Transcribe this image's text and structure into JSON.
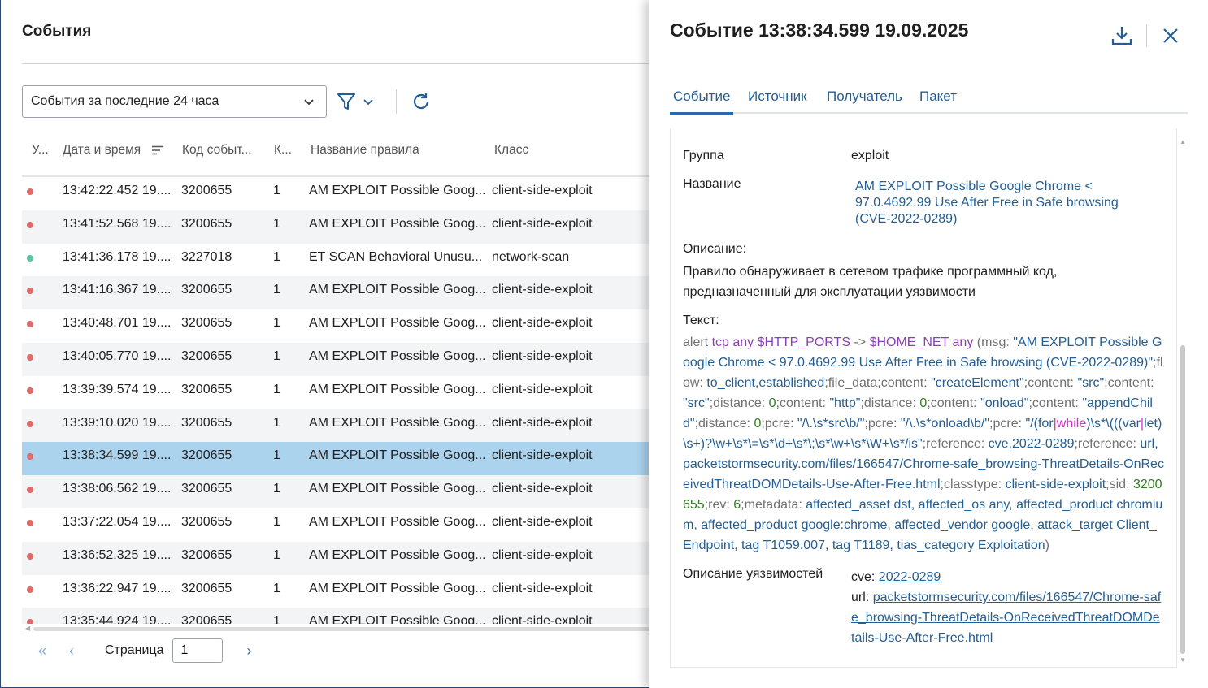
{
  "page": {
    "title": "События"
  },
  "toolbar": {
    "period": "События за последние 24 часа"
  },
  "table": {
    "headers": [
      "У...",
      "Дата и время",
      "Код событ...",
      "К...",
      "Название правила",
      "Класс"
    ],
    "rows": [
      {
        "level": "high",
        "datetime": "13:42:22.452 19....",
        "code": "3200655",
        "count": "1",
        "rule": "AM EXPLOIT Possible Goog...",
        "class": "client-side-exploit"
      },
      {
        "level": "high",
        "datetime": "13:41:52.568 19....",
        "code": "3200655",
        "count": "1",
        "rule": "AM EXPLOIT Possible Goog...",
        "class": "client-side-exploit"
      },
      {
        "level": "low",
        "datetime": "13:41:36.178 19....",
        "code": "3227018",
        "count": "1",
        "rule": "ET SCAN Behavioral Unusu...",
        "class": "network-scan"
      },
      {
        "level": "high",
        "datetime": "13:41:16.367 19....",
        "code": "3200655",
        "count": "1",
        "rule": "AM EXPLOIT Possible Goog...",
        "class": "client-side-exploit"
      },
      {
        "level": "high",
        "datetime": "13:40:48.701 19....",
        "code": "3200655",
        "count": "1",
        "rule": "AM EXPLOIT Possible Goog...",
        "class": "client-side-exploit"
      },
      {
        "level": "high",
        "datetime": "13:40:05.770 19....",
        "code": "3200655",
        "count": "1",
        "rule": "AM EXPLOIT Possible Goog...",
        "class": "client-side-exploit"
      },
      {
        "level": "high",
        "datetime": "13:39:39.574 19....",
        "code": "3200655",
        "count": "1",
        "rule": "AM EXPLOIT Possible Goog...",
        "class": "client-side-exploit"
      },
      {
        "level": "high",
        "datetime": "13:39:10.020 19....",
        "code": "3200655",
        "count": "1",
        "rule": "AM EXPLOIT Possible Goog...",
        "class": "client-side-exploit"
      },
      {
        "level": "high",
        "datetime": "13:38:34.599 19....",
        "code": "3200655",
        "count": "1",
        "rule": "AM EXPLOIT Possible Goog...",
        "class": "client-side-exploit"
      },
      {
        "level": "high",
        "datetime": "13:38:06.562 19....",
        "code": "3200655",
        "count": "1",
        "rule": "AM EXPLOIT Possible Goog...",
        "class": "client-side-exploit"
      },
      {
        "level": "high",
        "datetime": "13:37:22.054 19....",
        "code": "3200655",
        "count": "1",
        "rule": "AM EXPLOIT Possible Goog...",
        "class": "client-side-exploit"
      },
      {
        "level": "high",
        "datetime": "13:36:52.325 19....",
        "code": "3200655",
        "count": "1",
        "rule": "AM EXPLOIT Possible Goog...",
        "class": "client-side-exploit"
      },
      {
        "level": "high",
        "datetime": "13:36:22.947 19....",
        "code": "3200655",
        "count": "1",
        "rule": "AM EXPLOIT Possible Goog...",
        "class": "client-side-exploit"
      },
      {
        "level": "high",
        "datetime": "13:35:44.924 19....",
        "code": "3200655",
        "count": "1",
        "rule": "AM EXPLOIT Possible Goog...",
        "class": "client-side-exploit"
      }
    ],
    "selected_index": 8
  },
  "pager": {
    "label": "Страница",
    "page": "1"
  },
  "colors": {
    "level_high": "#e06b6b",
    "level_low": "#5ec4a6",
    "selected_row": "#acd3ee",
    "accent": "#2a6aab"
  },
  "icons": {
    "filter": "filter-icon",
    "refresh": "refresh-icon",
    "download": "download-icon",
    "close": "close-icon"
  },
  "panel": {
    "title": "Событие 13:38:34.599 19.09.2025",
    "tabs": [
      "Событие",
      "Источник",
      "Получатель",
      "Пакет"
    ],
    "group_label": "Группа",
    "group_value": "exploit",
    "name_label": "Название",
    "name_value": "AM EXPLOIT Possible Google Chrome < 97.0.4692.99 Use After Free in Safe browsing (CVE-2022-0289)",
    "description_label": "Описание:",
    "description_text": "Правило обнаруживает в сетевом трафике программный код, предназначенный для эксплуатации уязвимости",
    "text_label": "Текст:",
    "rule_tokens": [
      [
        "alert ",
        "g"
      ],
      [
        "tcp any $HTTP_PORTS ",
        "p"
      ],
      [
        "-> ",
        "g"
      ],
      [
        "$HOME_NET any ",
        "p"
      ],
      [
        "(msg: ",
        "g"
      ],
      [
        "\"AM EXPLOIT Possible Google Chrome < 97.0.4692.99 Use After Free in Safe browsing (CVE-2022-0289)\"",
        "b"
      ],
      [
        ";flow: ",
        "g"
      ],
      [
        "to_client,established",
        "b"
      ],
      [
        ";file_data;content: ",
        "g"
      ],
      [
        "\"createElement\"",
        "b"
      ],
      [
        ";content: ",
        "g"
      ],
      [
        "\"src\"",
        "b"
      ],
      [
        ";content: ",
        "g"
      ],
      [
        "\"src\"",
        "b"
      ],
      [
        ";distance: ",
        "g"
      ],
      [
        "0",
        "gr"
      ],
      [
        ";content: ",
        "g"
      ],
      [
        "\"http\"",
        "b"
      ],
      [
        ";distance: ",
        "g"
      ],
      [
        "0",
        "gr"
      ],
      [
        ";content: ",
        "g"
      ],
      [
        "\"onload\"",
        "b"
      ],
      [
        ";content: ",
        "g"
      ],
      [
        "\"appendChild\"",
        "b"
      ],
      [
        ";distance: ",
        "g"
      ],
      [
        "0",
        "gr"
      ],
      [
        ";pcre: ",
        "g"
      ],
      [
        "\"/\\.\\s*src\\b/\"",
        "b"
      ],
      [
        ";pcre: ",
        "g"
      ],
      [
        "\"/\\.\\s*onload\\b/\"",
        "b"
      ],
      [
        ";pcre: ",
        "g"
      ],
      [
        "\"/(for",
        "b"
      ],
      [
        "|",
        "m"
      ],
      [
        "while",
        "m"
      ],
      [
        ")\\s*\\(((var",
        "b"
      ],
      [
        "|",
        "m"
      ],
      [
        "let)\\s+)?\\w+\\s*\\=\\s*\\d+\\s*\\;\\s*\\w+\\s*\\W+\\s*/is\"",
        "b"
      ],
      [
        ";reference: ",
        "g"
      ],
      [
        "cve,2022-0289",
        "b"
      ],
      [
        ";reference: ",
        "g"
      ],
      [
        "url,packetstormsecurity.com/files/166547/Chrome-safe_browsing-ThreatDetails-OnReceivedThreatDOMDetails-Use-After-Free.html",
        "b"
      ],
      [
        ";classtype: ",
        "g"
      ],
      [
        "client-side-exploit",
        "b"
      ],
      [
        ";sid: ",
        "g"
      ],
      [
        "3200655",
        "gr"
      ],
      [
        ";rev: ",
        "g"
      ],
      [
        "6",
        "gr"
      ],
      [
        ";metadata: ",
        "g"
      ],
      [
        "affected_asset dst, affected_os any, affected_product chromium, affected_product google:chrome, affected_vendor google, attack_target Client_Endpoint, tag T1059.007, tag T1189, tias_category Exploitation",
        "b"
      ],
      [
        ")",
        "g"
      ]
    ],
    "vuln_label": "Описание уязвимостей",
    "cve_prefix": "cve:",
    "cve_value": "2022-0289",
    "url_prefix": "url:",
    "url_value": "packetstormsecurity.com/files/166547/Chrome-safe_browsing-ThreatDetails-OnReceivedThreatDOMDetails-Use-After-Free.html"
  }
}
